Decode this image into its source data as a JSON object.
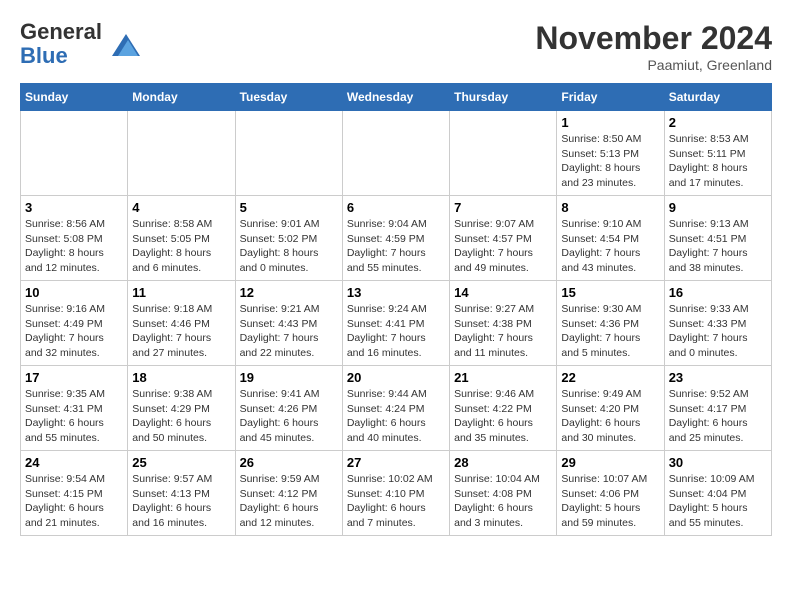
{
  "header": {
    "logo_line1": "General",
    "logo_line2": "Blue",
    "month": "November 2024",
    "location": "Paamiut, Greenland"
  },
  "weekdays": [
    "Sunday",
    "Monday",
    "Tuesday",
    "Wednesday",
    "Thursday",
    "Friday",
    "Saturday"
  ],
  "weeks": [
    [
      {
        "day": "",
        "info": ""
      },
      {
        "day": "",
        "info": ""
      },
      {
        "day": "",
        "info": ""
      },
      {
        "day": "",
        "info": ""
      },
      {
        "day": "",
        "info": ""
      },
      {
        "day": "1",
        "info": "Sunrise: 8:50 AM\nSunset: 5:13 PM\nDaylight: 8 hours and 23 minutes."
      },
      {
        "day": "2",
        "info": "Sunrise: 8:53 AM\nSunset: 5:11 PM\nDaylight: 8 hours and 17 minutes."
      }
    ],
    [
      {
        "day": "3",
        "info": "Sunrise: 8:56 AM\nSunset: 5:08 PM\nDaylight: 8 hours and 12 minutes."
      },
      {
        "day": "4",
        "info": "Sunrise: 8:58 AM\nSunset: 5:05 PM\nDaylight: 8 hours and 6 minutes."
      },
      {
        "day": "5",
        "info": "Sunrise: 9:01 AM\nSunset: 5:02 PM\nDaylight: 8 hours and 0 minutes."
      },
      {
        "day": "6",
        "info": "Sunrise: 9:04 AM\nSunset: 4:59 PM\nDaylight: 7 hours and 55 minutes."
      },
      {
        "day": "7",
        "info": "Sunrise: 9:07 AM\nSunset: 4:57 PM\nDaylight: 7 hours and 49 minutes."
      },
      {
        "day": "8",
        "info": "Sunrise: 9:10 AM\nSunset: 4:54 PM\nDaylight: 7 hours and 43 minutes."
      },
      {
        "day": "9",
        "info": "Sunrise: 9:13 AM\nSunset: 4:51 PM\nDaylight: 7 hours and 38 minutes."
      }
    ],
    [
      {
        "day": "10",
        "info": "Sunrise: 9:16 AM\nSunset: 4:49 PM\nDaylight: 7 hours and 32 minutes."
      },
      {
        "day": "11",
        "info": "Sunrise: 9:18 AM\nSunset: 4:46 PM\nDaylight: 7 hours and 27 minutes."
      },
      {
        "day": "12",
        "info": "Sunrise: 9:21 AM\nSunset: 4:43 PM\nDaylight: 7 hours and 22 minutes."
      },
      {
        "day": "13",
        "info": "Sunrise: 9:24 AM\nSunset: 4:41 PM\nDaylight: 7 hours and 16 minutes."
      },
      {
        "day": "14",
        "info": "Sunrise: 9:27 AM\nSunset: 4:38 PM\nDaylight: 7 hours and 11 minutes."
      },
      {
        "day": "15",
        "info": "Sunrise: 9:30 AM\nSunset: 4:36 PM\nDaylight: 7 hours and 5 minutes."
      },
      {
        "day": "16",
        "info": "Sunrise: 9:33 AM\nSunset: 4:33 PM\nDaylight: 7 hours and 0 minutes."
      }
    ],
    [
      {
        "day": "17",
        "info": "Sunrise: 9:35 AM\nSunset: 4:31 PM\nDaylight: 6 hours and 55 minutes."
      },
      {
        "day": "18",
        "info": "Sunrise: 9:38 AM\nSunset: 4:29 PM\nDaylight: 6 hours and 50 minutes."
      },
      {
        "day": "19",
        "info": "Sunrise: 9:41 AM\nSunset: 4:26 PM\nDaylight: 6 hours and 45 minutes."
      },
      {
        "day": "20",
        "info": "Sunrise: 9:44 AM\nSunset: 4:24 PM\nDaylight: 6 hours and 40 minutes."
      },
      {
        "day": "21",
        "info": "Sunrise: 9:46 AM\nSunset: 4:22 PM\nDaylight: 6 hours and 35 minutes."
      },
      {
        "day": "22",
        "info": "Sunrise: 9:49 AM\nSunset: 4:20 PM\nDaylight: 6 hours and 30 minutes."
      },
      {
        "day": "23",
        "info": "Sunrise: 9:52 AM\nSunset: 4:17 PM\nDaylight: 6 hours and 25 minutes."
      }
    ],
    [
      {
        "day": "24",
        "info": "Sunrise: 9:54 AM\nSunset: 4:15 PM\nDaylight: 6 hours and 21 minutes."
      },
      {
        "day": "25",
        "info": "Sunrise: 9:57 AM\nSunset: 4:13 PM\nDaylight: 6 hours and 16 minutes."
      },
      {
        "day": "26",
        "info": "Sunrise: 9:59 AM\nSunset: 4:12 PM\nDaylight: 6 hours and 12 minutes."
      },
      {
        "day": "27",
        "info": "Sunrise: 10:02 AM\nSunset: 4:10 PM\nDaylight: 6 hours and 7 minutes."
      },
      {
        "day": "28",
        "info": "Sunrise: 10:04 AM\nSunset: 4:08 PM\nDaylight: 6 hours and 3 minutes."
      },
      {
        "day": "29",
        "info": "Sunrise: 10:07 AM\nSunset: 4:06 PM\nDaylight: 5 hours and 59 minutes."
      },
      {
        "day": "30",
        "info": "Sunrise: 10:09 AM\nSunset: 4:04 PM\nDaylight: 5 hours and 55 minutes."
      }
    ]
  ]
}
